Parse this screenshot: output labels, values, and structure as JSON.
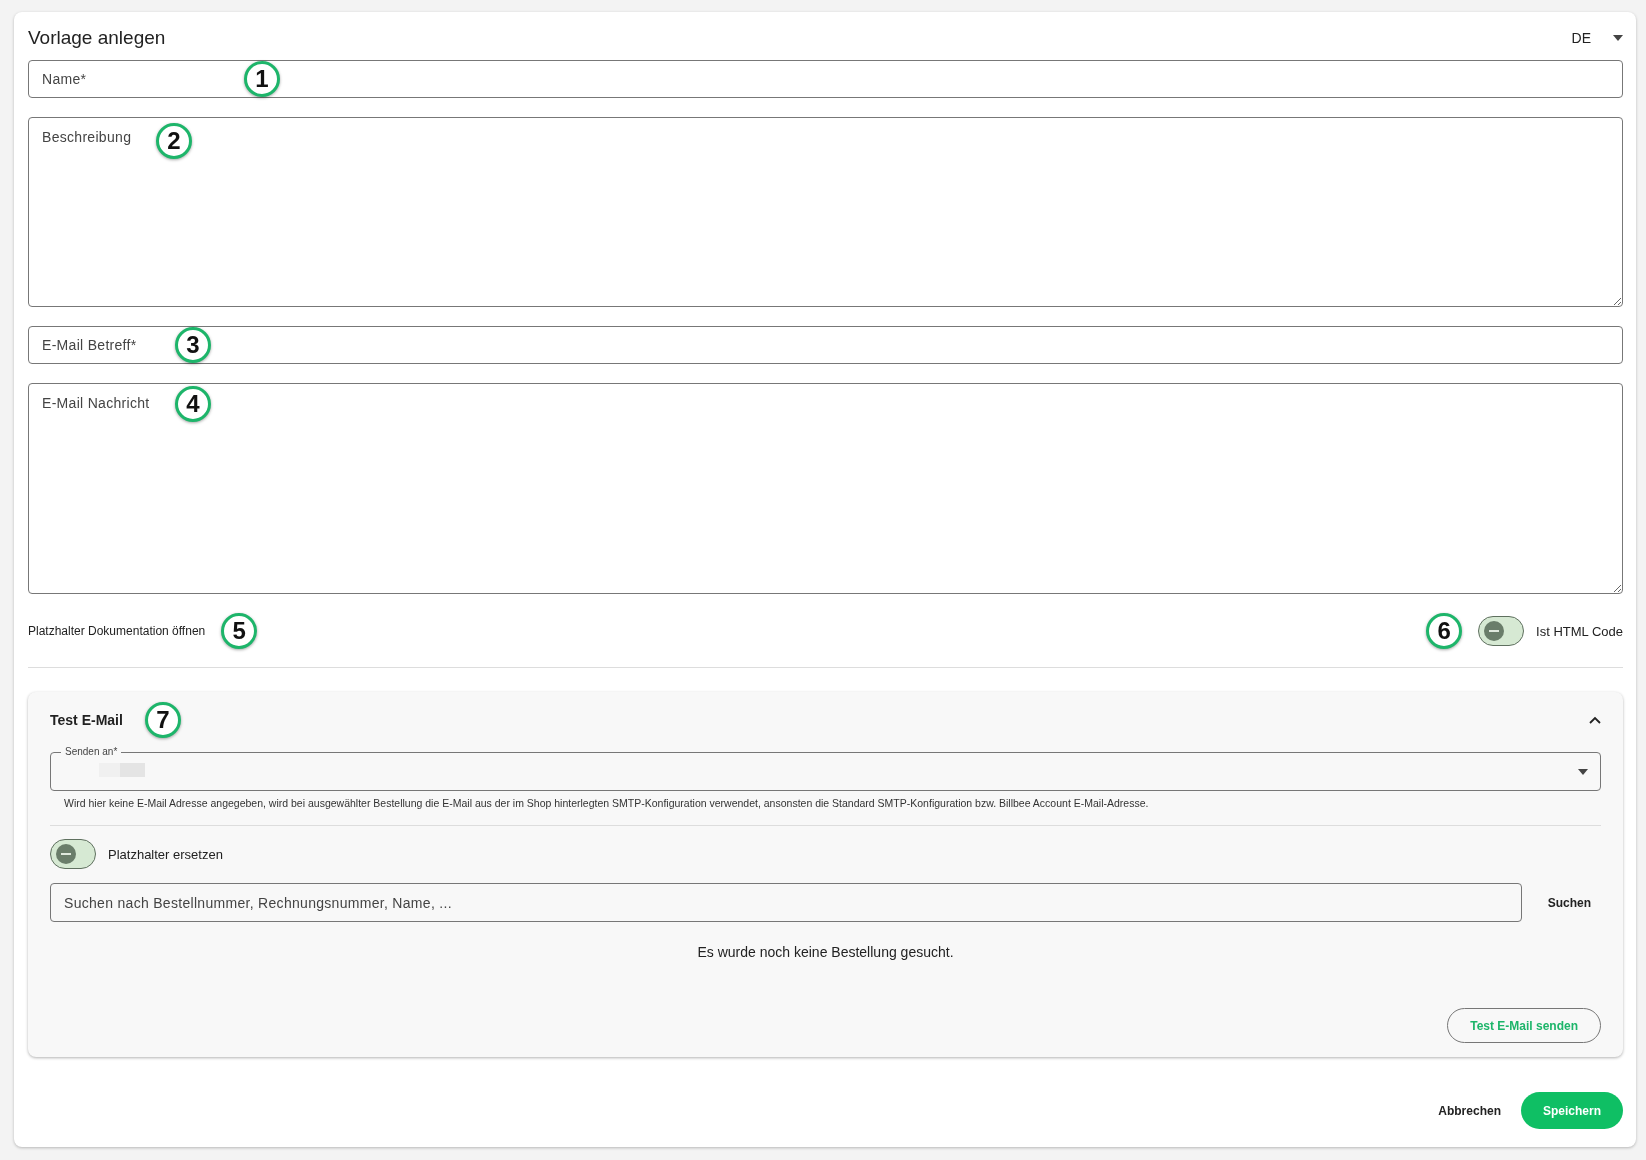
{
  "dialog": {
    "title": "Vorlage anlegen",
    "language": "DE"
  },
  "fields": [
    {
      "kind": "input",
      "placeholder": "Name*",
      "callout": "1"
    },
    {
      "kind": "textarea",
      "placeholder": "Beschreibung",
      "callout": "2"
    },
    {
      "kind": "input",
      "placeholder": "E-Mail Betreff*",
      "callout": "3"
    },
    {
      "kind": "textarea",
      "placeholder": "E-Mail Nachricht",
      "callout": "4"
    }
  ],
  "placeholder_link": {
    "label": "Platzhalter Dokumentation öffnen",
    "callout": "5"
  },
  "html_toggle": {
    "label": "Ist HTML Code",
    "on": false,
    "callout": "6"
  },
  "test_email": {
    "title": "Test E-Mail",
    "callout": "7",
    "expanded": true,
    "recipient": {
      "label": "Senden an*",
      "hint": "Wird hier keine E-Mail Adresse angegeben, wird bei ausgewählter Bestellung die E-Mail aus der im Shop hinterlegten SMTP-Konfiguration verwendet, ansonsten die Standard SMTP-Konfiguration bzw. Billbee Account E-Mail-Adresse."
    },
    "replace_toggle": {
      "label": "Platzhalter ersetzen",
      "on": false
    },
    "search": {
      "placeholder": "Suchen nach Bestellnummer, Rechnungsnummer, Name, ...",
      "button": "Suchen"
    },
    "empty_message": "Es wurde noch keine Bestellung gesucht.",
    "send_button": "Test E-Mail senden"
  },
  "actions": [
    {
      "kind": "text",
      "label": "Abbrechen"
    },
    {
      "kind": "filled",
      "label": "Speichern"
    }
  ]
}
